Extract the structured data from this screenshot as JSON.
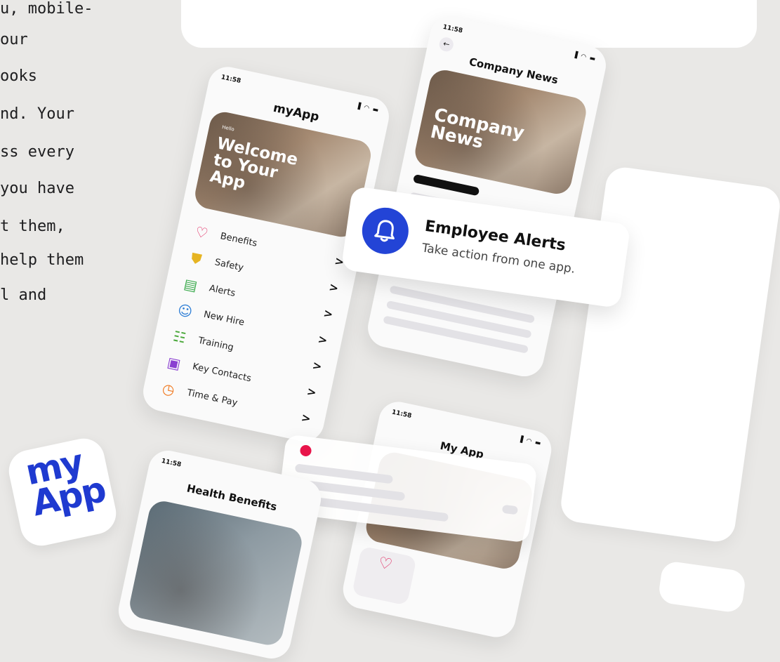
{
  "intro": {
    "lines": [
      "u, mobile-",
      "our",
      "ooks",
      "nd. Your",
      "ss every",
      " you have",
      "t them,",
      "help them",
      "l and"
    ]
  },
  "menu_phone": {
    "time": "11:58",
    "status": "▐ ◠ ▬",
    "title": "myApp",
    "hero_small": "Hello",
    "hero_big": "Welcome to Your App",
    "items": [
      {
        "label": "Benefits",
        "icon": "heart-plus-icon",
        "glyph": "♡",
        "color": "#e0245e"
      },
      {
        "label": "Safety",
        "icon": "shield-check-icon",
        "glyph": "⛊",
        "color": "#e6b422"
      },
      {
        "label": "Alerts",
        "icon": "phone-alert-icon",
        "glyph": "▤",
        "color": "#3cab4e"
      },
      {
        "label": "New Hire",
        "icon": "add-user-icon",
        "glyph": "☺",
        "color": "#2f7fd6"
      },
      {
        "label": "Training",
        "icon": "presentation-icon",
        "glyph": "☷",
        "color": "#4aa83a"
      },
      {
        "label": "Key Contacts",
        "icon": "contact-book-icon",
        "glyph": "▣",
        "color": "#8a3fd1"
      },
      {
        "label": "Time & Pay",
        "icon": "clock-coin-icon",
        "glyph": "◷",
        "color": "#f07a22"
      }
    ],
    "chevron": ">"
  },
  "news_phone": {
    "time": "11:58",
    "status": "▐ ◠ ▬",
    "title": "Company News",
    "hero_text": "Company News",
    "back": "←"
  },
  "alert_card": {
    "title": "Employee Alerts",
    "subtitle": "Take action from one app."
  },
  "myapp_phone": {
    "time": "11:58",
    "status": "▐ ◠ ▬",
    "title": "My App"
  },
  "health_phone": {
    "time": "11:58",
    "title": "Health Benefits"
  },
  "app_icon": {
    "line1": "my",
    "line2": "App"
  },
  "colors": {
    "background": "#e9e8e6",
    "accent_blue": "#2344d6",
    "notif_red": "#e8144a"
  }
}
